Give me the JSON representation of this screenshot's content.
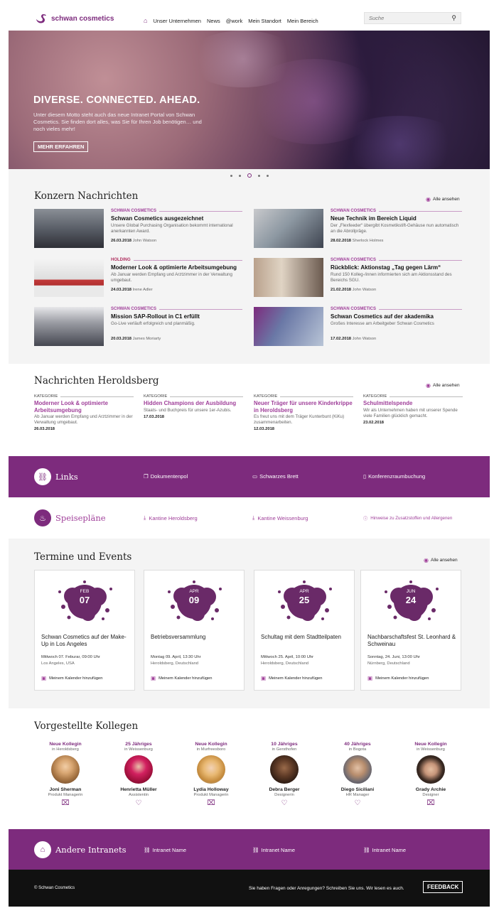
{
  "header": {
    "logo_text": "schwan cosmetics",
    "nav": [
      "Unser Unternehmen",
      "News",
      "@work",
      "Mein Standort",
      "Mein Bereich"
    ],
    "search_placeholder": "Suche"
  },
  "hero": {
    "title": "DIVERSE. CONNECTED. AHEAD.",
    "text": "Unter diesem Motto steht auch das neue Intranet Portal von Schwan Cosmetics. Sie finden dort alles, was Sie für Ihren Job benötigen… und noch vieles mehr!",
    "button": "MEHR ERFAHREN",
    "slide_count": 5,
    "active_slide": 3
  },
  "konzern": {
    "title": "Konzern Nachrichten",
    "see_all": "Alle ansehen",
    "items": [
      {
        "category": "SCHWAN COSMETICS",
        "title": "Schwan Cosmetics ausgezeichnet",
        "desc": "Unsere Global Purchasing Organisation bekommt international anerkannten Award.",
        "date": "26.03.2018",
        "author": "John Watson"
      },
      {
        "category": "SCHWAN COSMETICS",
        "title": "Neue Technik im Bereich Liquid",
        "desc": "Der „Flexfeeder“ übergibt Kosmetikstift-Gehäuse nun automatisch an die Abrollprägе.",
        "date": "28.02.2018",
        "author": "Sherlock Holmes"
      },
      {
        "category": "HOLDING",
        "title": "Moderner Look & optimierte Arbeitsumgebung",
        "desc": "Ab Januar werden Empfang und Arztzimmer in der Verwaltung umgebaut.",
        "date": "24.03.2018",
        "author": "Irene Adler"
      },
      {
        "category": "SCHWAN COSMETICS",
        "title": "Rückblick: Aktionstag „Tag gegen Lärm“",
        "desc": "Rund 150 Kolleg-/innen informierten sich am Aktionsstand des Bereichs SGU.",
        "date": "21.02.2018",
        "author": "John Watson"
      },
      {
        "category": "SCHWAN COSMETICS",
        "title": "Mission SAP-Rollout in C1 erfüllt",
        "desc": "Go-Live verläuft erfolgreich und planmäßig.",
        "date": "20.03.2018",
        "author": "James Moriarty"
      },
      {
        "category": "SCHWAN COSMETICS",
        "title": "Schwan Cosmetics auf der akademika",
        "desc": "Großes Interesse am Arbeitgeber Schwan Cosmetics",
        "date": "17.02.2018",
        "author": "John Watson"
      }
    ]
  },
  "heroldsberg": {
    "title": "Nachrichten Heroldsberg",
    "see_all": "Alle ansehen",
    "items": [
      {
        "category": "KATEGORIE",
        "title": "Moderner Look & optimierte Arbeitsumgebung",
        "desc": "Ab Januar werden Empfang und Arztzimmer in der Verwaltung umgebaut.",
        "date": "26.03.2018"
      },
      {
        "category": "KATEGORIE",
        "title": "Hidden Champions der Ausbildung",
        "desc": "Staats- und Buchpreis für unsere 1er-Azubis.",
        "date": "17.03.2018"
      },
      {
        "category": "KATEGORIE",
        "title": "Neuer Träger für unsere Kinderkrippe in Heroldsberg",
        "desc": "Es freut uns mit dem Träger Kunterbunt (KiKu) zusammenarbeiten.",
        "date": "12.03.2018"
      },
      {
        "category": "KATEGORIE",
        "title": "Schulmittelspende",
        "desc": "Wir als Unternehmen haben mit unserer Spende viele Familien glücklich gemacht.",
        "date": "23.02.2018"
      }
    ]
  },
  "links": {
    "title": "Links",
    "items": [
      "Dokumentenpol",
      "Schwarzes Brett",
      "Konferenzraumbuchung"
    ]
  },
  "speiseplaene": {
    "title": "Speisepläne",
    "items": [
      "Kantine Heroldsberg",
      "Kantine Weissenburg"
    ],
    "info": "Hinweise zu Zusatzstoffen und Allergenen"
  },
  "events": {
    "title": "Termine und Events",
    "see_all": "Alle ansehen",
    "calendar_label": "Meinem Kalender hinzufügen",
    "items": [
      {
        "month": "FEB",
        "day": "07",
        "title": "Schwan Cosmetics auf der Make-Up in Los Angeles",
        "when": "Mittwoch 07. Feburar, 09:00 Uhr",
        "where": "Los Angeles, USA"
      },
      {
        "month": "APR",
        "day": "09",
        "title": "Betriebsversammlung",
        "when": "Montag 09. April, 13:30 Uhr",
        "where": "Heroldsberg, Deutschland"
      },
      {
        "month": "APR",
        "day": "25",
        "title": "Schultag mit dem Stadtteilpaten",
        "when": "Mittwoch 25. April, 10:00 Uhr",
        "where": "Heroldsberg, Deutschland"
      },
      {
        "month": "JUN",
        "day": "24",
        "title": "Nachbarschaftsfest St. Leonhard & Schweinau",
        "when": "Sonntag, 24. Juni, 13:00 Uhr",
        "where": "Nürnberg, Deutschland"
      }
    ]
  },
  "colleagues": {
    "title": "Vorgestellte Kollegen",
    "items": [
      {
        "badge": "Neue Kollegin",
        "loc": "in Heroldsberg",
        "name": "Joni Sherman",
        "role": "Produkt Managerin",
        "action_icon": "gift-icon"
      },
      {
        "badge": "25 Jähriges",
        "loc": "in Weissenburg",
        "name": "Henrietta Müller",
        "role": "Assistentin",
        "action_icon": "handshake-icon"
      },
      {
        "badge": "Neue Kollegin",
        "loc": "in Murfreesboro",
        "name": "Lydia Holloway",
        "role": "Produkt Managerin",
        "action_icon": "gift-icon"
      },
      {
        "badge": "10 Jähriges",
        "loc": "in Gersthofen",
        "name": "Debra Berger",
        "role": "Designerin",
        "action_icon": "handshake-icon"
      },
      {
        "badge": "40 Jähriges",
        "loc": "in Bogota",
        "name": "Diego Siciliani",
        "role": "HR Manager",
        "action_icon": "handshake-icon"
      },
      {
        "badge": "Neue Kollegin",
        "loc": "in Weissenburg",
        "name": "Grady Archie",
        "role": "Designer",
        "action_icon": "gift-icon"
      }
    ]
  },
  "intranets": {
    "title": "Andere Intranets",
    "items": [
      "Intranet Name",
      "Intranet Name",
      "Intranet Name"
    ]
  },
  "footer": {
    "copyright": "© Schwan Cosmetics",
    "message": "Sie haben Fragen oder Anregungen? Schreiben Sie uns. Wir lesen es auch.",
    "feedback": "FEEDBACK"
  },
  "colors": {
    "accent": "#7d2b7d",
    "accent_light": "#a0409a",
    "footer": "#111111"
  }
}
